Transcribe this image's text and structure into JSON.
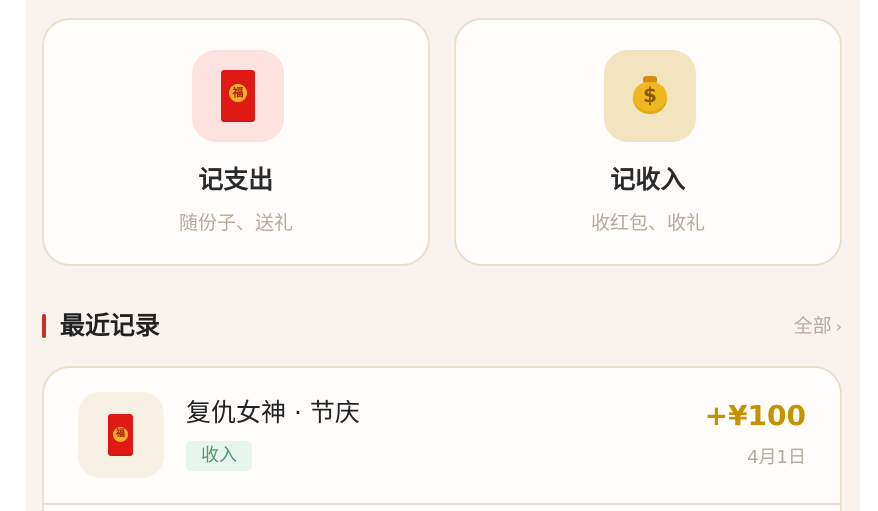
{
  "cards": {
    "expense": {
      "title": "记支出",
      "subtitle": "随份子、送礼",
      "icon": "red-envelope-icon",
      "icon_symbol": "福"
    },
    "income": {
      "title": "记收入",
      "subtitle": "收红包、收礼",
      "icon": "money-bag-icon",
      "icon_symbol": "$"
    }
  },
  "recent": {
    "title": "最近记录",
    "see_all": "全部",
    "chevron": "›",
    "items": [
      {
        "icon": "red-envelope-icon",
        "icon_symbol": "福",
        "title": "复仇女神 · 节庆",
        "tag": "收入",
        "amount": "+¥100",
        "date": "4月1日"
      }
    ]
  },
  "colors": {
    "accent_red": "#c83027",
    "amount_gold": "#c69200",
    "income_tag_text": "#4e9a6e",
    "income_tag_bg": "#e7f5ee"
  }
}
